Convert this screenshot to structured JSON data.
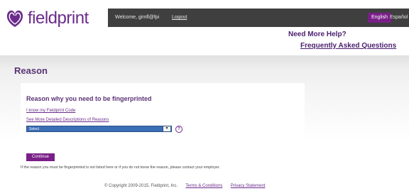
{
  "logo": {
    "text": "fieldprint",
    "icon": "fieldprint-logo-icon"
  },
  "topbar": {
    "welcome": "Welcome, gimfl@fpi",
    "logout": "Logout",
    "lang_english": "English",
    "lang_espanol": "Español"
  },
  "help": {
    "title": "Need More Help?",
    "faq": "Frequently Asked Questions"
  },
  "page": {
    "title": "Reason",
    "section_title": "Reason why you need to be fingerprinted",
    "link_code": "I know my Fieldprint Code",
    "link_reasons": "See More Detailed Descriptions of Reasons",
    "select_value": "Select",
    "help_icon": "?",
    "continue": "Continue",
    "notice": "If the reason you must be fingerprinted is not listed here or if you do not know the reason, please contact your employer."
  },
  "footer": {
    "copyright": "© Copyright 2009-2015, Fieldprint, Inc.",
    "terms": "Terms & Conditions",
    "privacy": "Privacy Statement"
  },
  "colors": {
    "brand_purple": "#6b2c8b",
    "topbar": "#3f3f3f",
    "select_blue": "#3b6fb6"
  }
}
